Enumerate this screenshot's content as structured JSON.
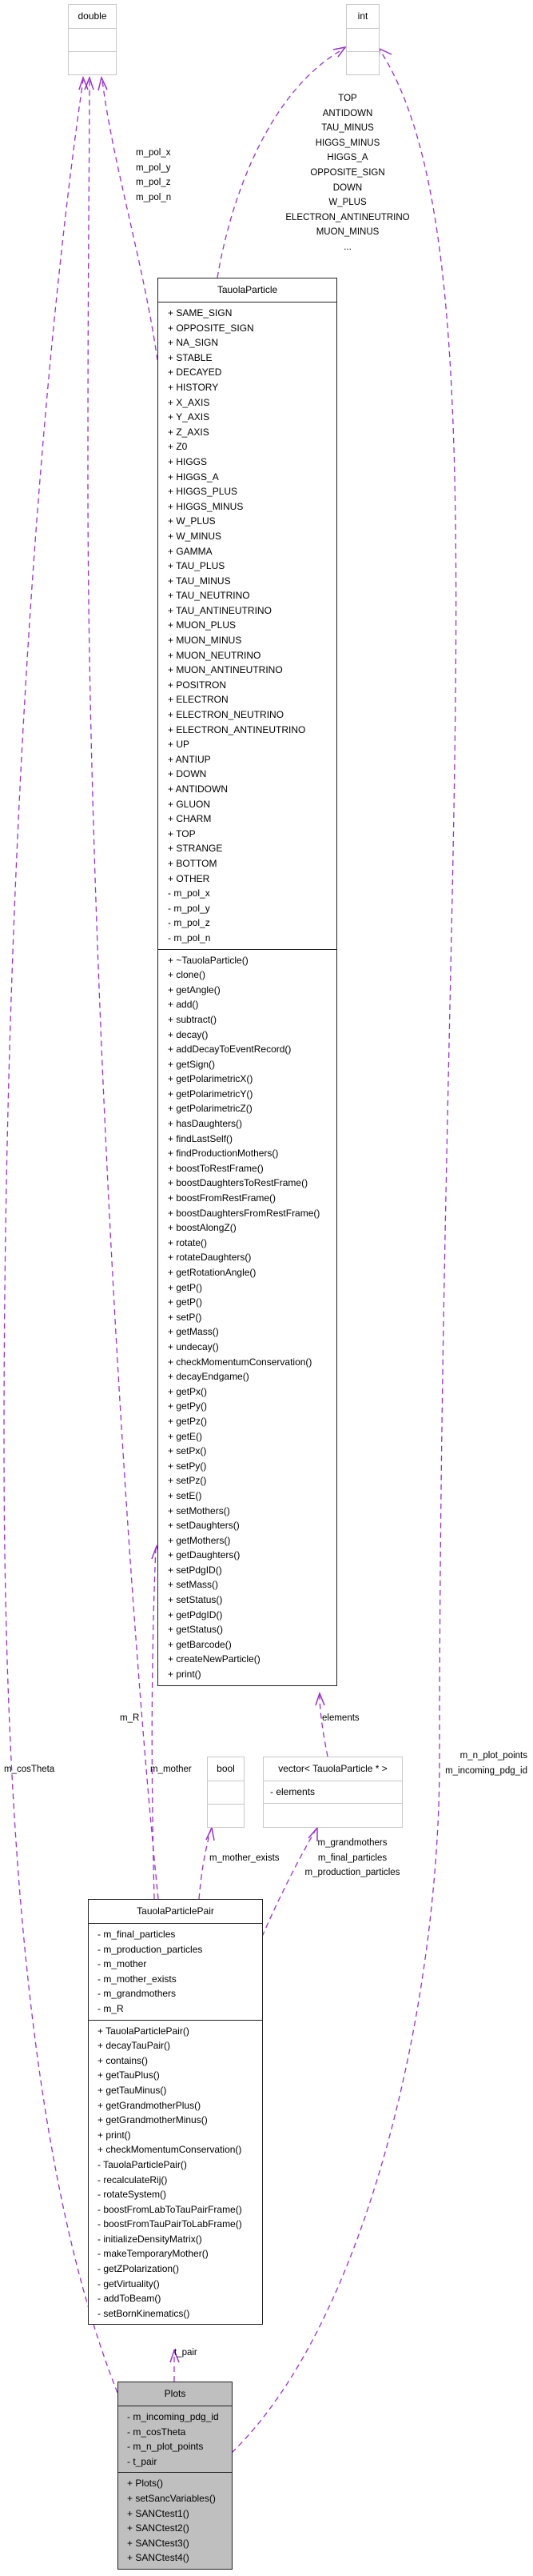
{
  "colors": {
    "edge": "#9a32cd",
    "focus_fill": "#bfbfbf",
    "ext_border": "#c8c8c8"
  },
  "classes": {
    "double": {
      "name": "double",
      "attributes": [],
      "methods": []
    },
    "int": {
      "name": "int",
      "attributes": [],
      "methods": []
    },
    "bool": {
      "name": "bool",
      "attributes": [],
      "methods": []
    },
    "vector": {
      "name": "vector< TauolaParticle * >",
      "attributes": [
        "- elements"
      ],
      "methods": []
    },
    "tauola_particle": {
      "name": "TauolaParticle",
      "attributes": [
        "+ SAME_SIGN",
        "+ OPPOSITE_SIGN",
        "+ NA_SIGN",
        "+ STABLE",
        "+ DECAYED",
        "+ HISTORY",
        "+ X_AXIS",
        "+ Y_AXIS",
        "+ Z_AXIS",
        "+ Z0",
        "+ HIGGS",
        "+ HIGGS_A",
        "+ HIGGS_PLUS",
        "+ HIGGS_MINUS",
        "+ W_PLUS",
        "+ W_MINUS",
        "+ GAMMA",
        "+ TAU_PLUS",
        "+ TAU_MINUS",
        "+ TAU_NEUTRINO",
        "+ TAU_ANTINEUTRINO",
        "+ MUON_PLUS",
        "+ MUON_MINUS",
        "+ MUON_NEUTRINO",
        "+ MUON_ANTINEUTRINO",
        "+ POSITRON",
        "+ ELECTRON",
        "+ ELECTRON_NEUTRINO",
        "+ ELECTRON_ANTINEUTRINO",
        "+ UP",
        "+ ANTIUP",
        "+ DOWN",
        "+ ANTIDOWN",
        "+ GLUON",
        "+ CHARM",
        "+ TOP",
        "+ STRANGE",
        "+ BOTTOM",
        "+ OTHER",
        "- m_pol_x",
        "- m_pol_y",
        "- m_pol_z",
        "- m_pol_n"
      ],
      "methods": [
        "+ ~TauolaParticle()",
        "+ clone()",
        "+ getAngle()",
        "+ add()",
        "+ subtract()",
        "+ decay()",
        "+ addDecayToEventRecord()",
        "+ getSign()",
        "+ getPolarimetricX()",
        "+ getPolarimetricY()",
        "+ getPolarimetricZ()",
        "+ hasDaughters()",
        "+ findLastSelf()",
        "+ findProductionMothers()",
        "+ boostToRestFrame()",
        "+ boostDaughtersToRestFrame()",
        "+ boostFromRestFrame()",
        "+ boostDaughtersFromRestFrame()",
        "+ boostAlongZ()",
        "+ rotate()",
        "+ rotateDaughters()",
        "+ getRotationAngle()",
        "+ getP()",
        "+ getP()",
        "+ setP()",
        "+ getMass()",
        "+ undecay()",
        "+ checkMomentumConservation()",
        "+ decayEndgame()",
        "+ getPx()",
        "+ getPy()",
        "+ getPz()",
        "+ getE()",
        "+ setPx()",
        "+ setPy()",
        "+ setPz()",
        "+ setE()",
        "+ setMothers()",
        "+ setDaughters()",
        "+ getMothers()",
        "+ getDaughters()",
        "+ setPdgID()",
        "+ setMass()",
        "+ setStatus()",
        "+ getPdgID()",
        "+ getStatus()",
        "+ getBarcode()",
        "+ createNewParticle()",
        "+ print()"
      ]
    },
    "tauola_particle_pair": {
      "name": "TauolaParticlePair",
      "attributes": [
        "- m_final_particles",
        "- m_production_particles",
        "- m_mother",
        "- m_mother_exists",
        "- m_grandmothers",
        "- m_R"
      ],
      "methods": [
        "+ TauolaParticlePair()",
        "+ decayTauPair()",
        "+ contains()",
        "+ getTauPlus()",
        "+ getTauMinus()",
        "+ getGrandmotherPlus()",
        "+ getGrandmotherMinus()",
        "+ print()",
        "+ checkMomentumConservation()",
        "- TauolaParticlePair()",
        "- recalculateRij()",
        "- rotateSystem()",
        "- boostFromLabToTauPairFrame()",
        "- boostFromTauPairToLabFrame()",
        "- initializeDensityMatrix()",
        "- makeTemporaryMother()",
        "- getZPolarization()",
        "- getVirtuality()",
        "- addToBeam()",
        "- setBornKinematics()"
      ]
    },
    "plots": {
      "name": "Plots",
      "attributes": [
        "- m_incoming_pdg_id",
        "- m_cosTheta",
        "- m_n_plot_points",
        "- t_pair"
      ],
      "methods": [
        "+ Plots()",
        "+ setSancVariables()",
        "+ SANCtest1()",
        "+ SANCtest2()",
        "+ SANCtest3()",
        "+ SANCtest4()"
      ]
    }
  },
  "edge_labels": {
    "particle_to_double": [
      "m_pol_x",
      "m_pol_y",
      "m_pol_z",
      "m_pol_n"
    ],
    "particle_to_int": [
      "TOP",
      "ANTIDOWN",
      "TAU_MINUS",
      "HIGGS_MINUS",
      "HIGGS_A",
      "OPPOSITE_SIGN",
      "DOWN",
      "W_PLUS",
      "ELECTRON_ANTINEUTRINO",
      "MUON_MINUS",
      "..."
    ],
    "vector_to_particle": [
      "elements"
    ],
    "pair_to_particle": [
      "m_mother"
    ],
    "pair_to_double": [
      "m_R"
    ],
    "plots_to_double": [
      "m_cosTheta"
    ],
    "plots_to_int": [
      "m_n_plot_points",
      "m_incoming_pdg_id"
    ],
    "pair_to_bool": [
      "m_mother_exists"
    ],
    "pair_to_vector": [
      "m_grandmothers",
      "m_final_particles",
      "m_production_particles"
    ],
    "plots_to_pair": [
      "t_pair"
    ]
  }
}
